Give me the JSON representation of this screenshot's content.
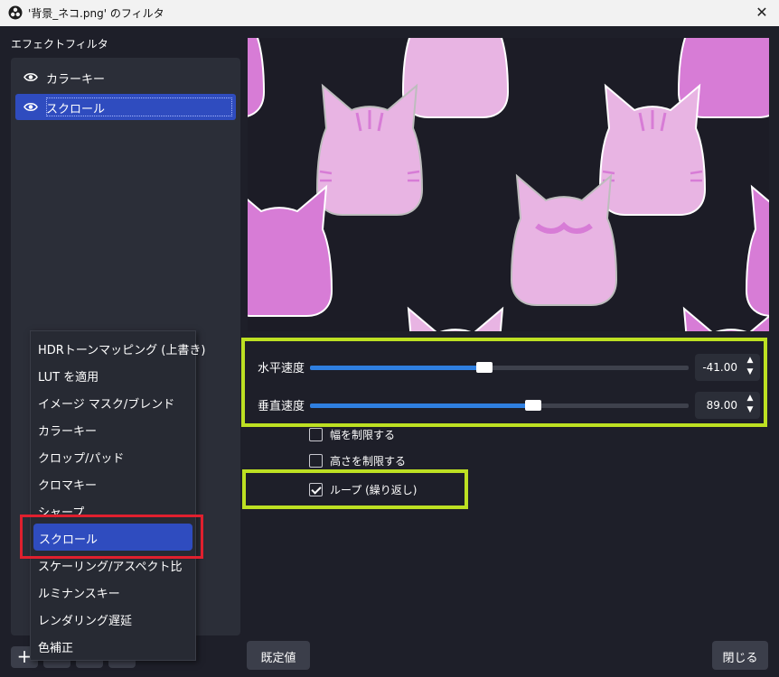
{
  "window": {
    "title": "'背景_ネコ.png' のフィルタ",
    "close_glyph": "✕"
  },
  "sidebar": {
    "section_label": "エフェクトフィルタ",
    "filters": [
      {
        "label": "カラーキー",
        "visible": true,
        "selected": false
      },
      {
        "label": "スクロール",
        "visible": true,
        "selected": true
      }
    ],
    "add_glyph": "+"
  },
  "add_menu": {
    "items": [
      "HDRトーンマッピング (上書き)",
      "LUT を適用",
      "イメージ マスク/ブレンド",
      "カラーキー",
      "クロップ/パッド",
      "クロマキー",
      "シャープ",
      "スクロール",
      "スケーリング/アスペクト比",
      "ルミナンスキー",
      "レンダリング遅延",
      "色補正"
    ],
    "active_index": 7
  },
  "properties": {
    "horizontal_speed": {
      "label": "水平速度",
      "value": "-41.00",
      "slider_fraction": 0.46
    },
    "vertical_speed": {
      "label": "垂直速度",
      "value": "89.00",
      "slider_fraction": 0.59
    },
    "limit_width": {
      "label": "幅を制限する",
      "checked": false
    },
    "limit_height": {
      "label": "高さを制限する",
      "checked": false
    },
    "loop": {
      "label": "ループ (繰り返し)",
      "checked": true
    }
  },
  "footer": {
    "defaults_label": "既定値",
    "close_label": "閉じる"
  },
  "colors": {
    "accent": "#2f4cbf",
    "slider_fill": "#2f7fe0",
    "highlight_green": "#bde022",
    "highlight_red": "#e0202e",
    "cat_pink": "#e6a8df",
    "cat_magenta": "#d77cd6"
  }
}
